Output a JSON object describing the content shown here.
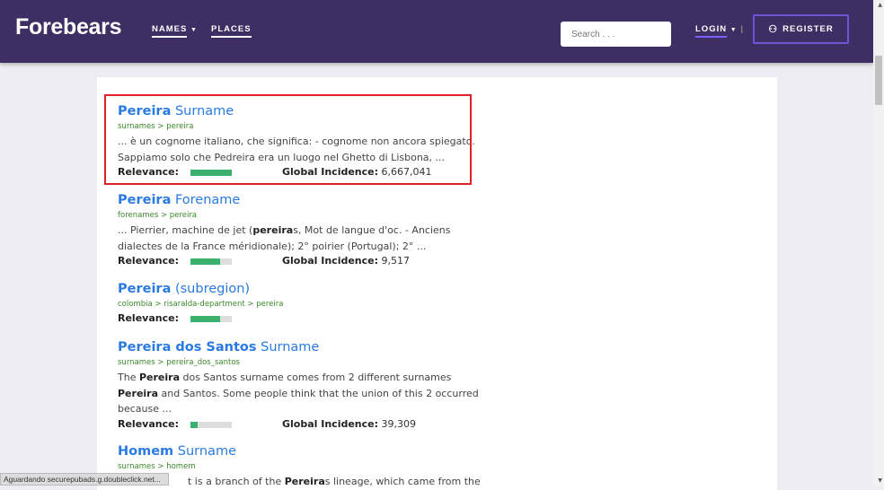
{
  "header": {
    "logo": "Forebears",
    "nav": [
      {
        "label": "NAMES"
      },
      {
        "label": "PLACES"
      }
    ],
    "search_placeholder": "Search . . .",
    "login": "LOGIN",
    "register": "REGISTER"
  },
  "labels": {
    "relevance": "Relevance:",
    "global_incidence": "Global Incidence:"
  },
  "results": [
    {
      "title_bold": "Pereira",
      "title_rest": " Surname",
      "crumb": "surnames > pereira",
      "desc1": "... è un cognome italiano, che significa: - cognome non ancora spiegato.",
      "desc2": "Sappiamo solo che Pedreira era un luogo nel Ghetto di Lisbona, ...",
      "relevance": 1.0,
      "incidence": "6,667,041"
    },
    {
      "title_bold": "Pereira",
      "title_rest": " Forename",
      "crumb": "forenames > pereira",
      "d_a": "... Pierrier, machine de jet (",
      "d_b": "pereira",
      "d_c": "s, Mot de langue d'oc. - Anciens dialectes de la France méridionale); 2° poirier (Portugal); 2° ...",
      "relevance": 0.72,
      "incidence": "9,517"
    },
    {
      "title_bold": "Pereira",
      "title_rest": " (subregion)",
      "crumb": "colombia > risaralda-department > pereira",
      "relevance": 0.72
    },
    {
      "title_bold": "Pereira dos Santos",
      "title_rest": " Surname",
      "crumb": "surnames > pereira_dos_santos",
      "d_a": "The ",
      "d_b": "Pereira",
      "d_c": " dos Santos surname comes from 2 different surnames ",
      "d_d": "Pereira",
      "d_e": " and Santos. Some people think that the union of this 2 occurred because ...",
      "relevance": 0.17,
      "incidence": "39,309"
    },
    {
      "title_bold": "Homem",
      "title_rest": " Surname",
      "crumb": "surnames > homem",
      "d_a": "t is a branch of the ",
      "d_b": "Pereira",
      "d_c": "s lineage, which came from the"
    }
  ],
  "status_bar": "Aguardando securepubads.g.doubleclick.net..."
}
